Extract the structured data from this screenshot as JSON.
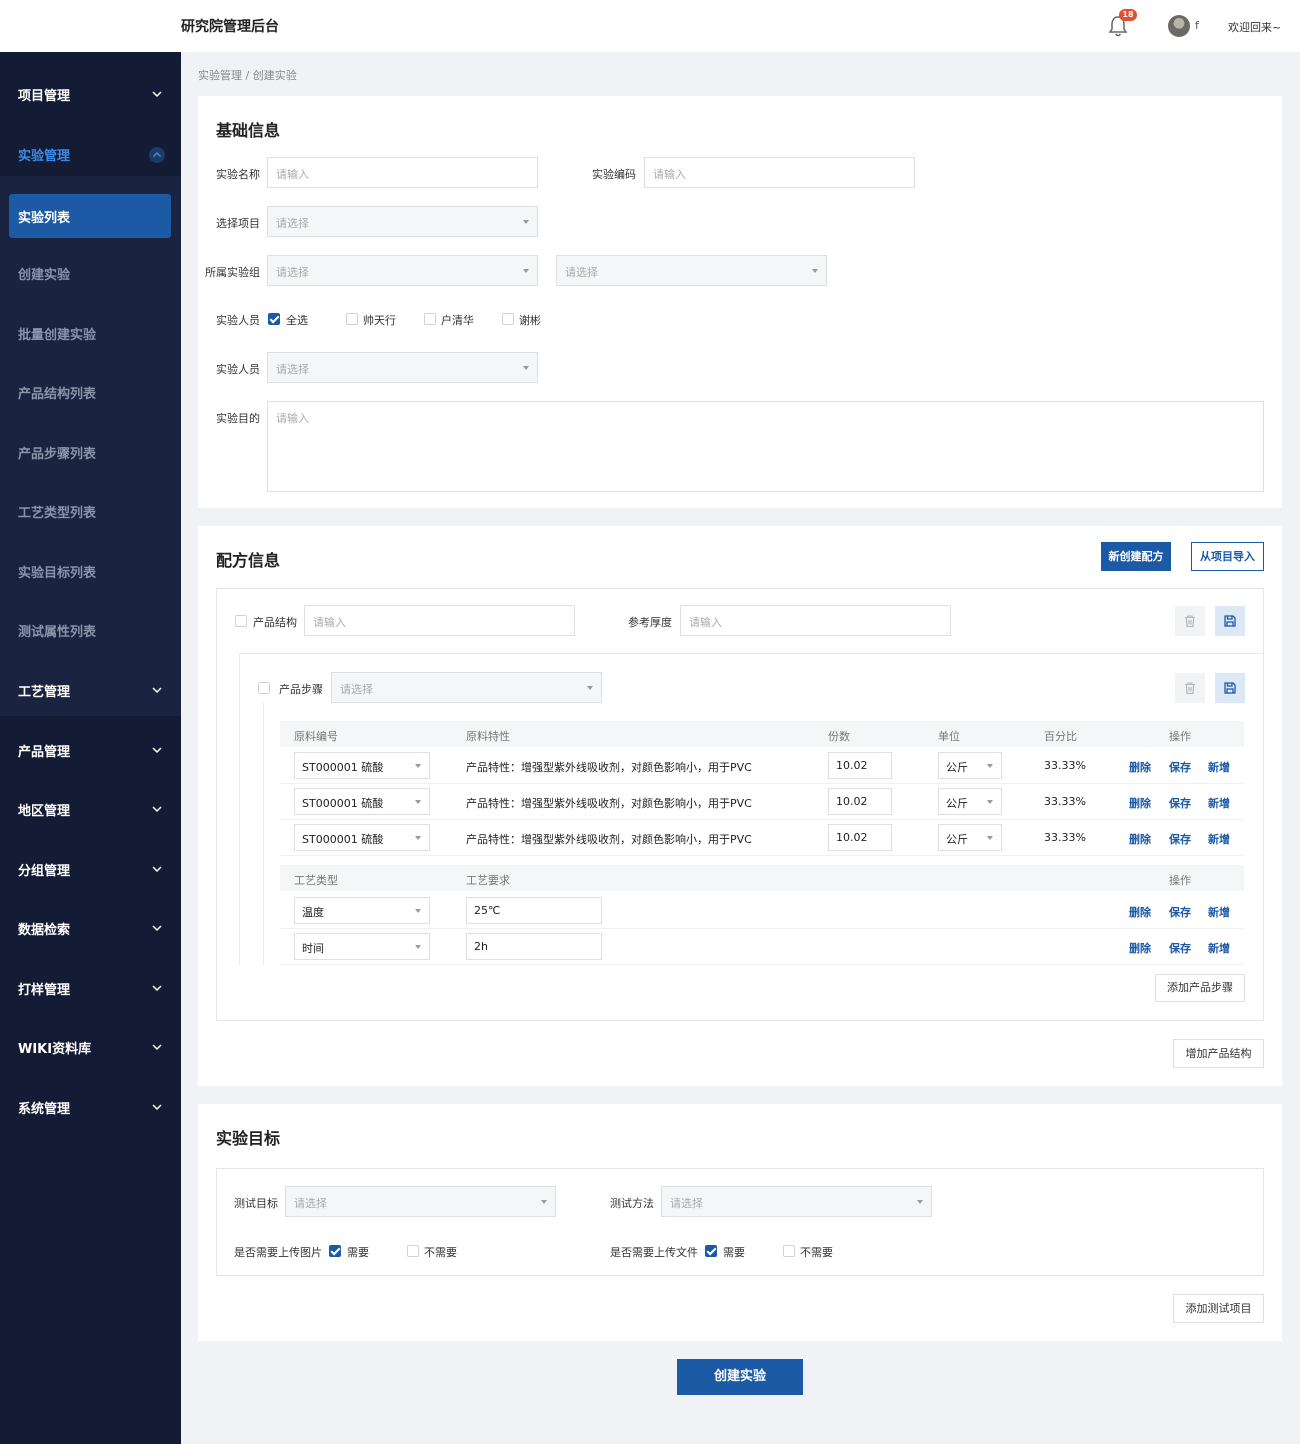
{
  "header": {
    "app_title": "研究院管理后台",
    "notification_count": "18",
    "user_initial": "f",
    "welcome": "欢迎回来~"
  },
  "sidebar": {
    "groups_top": [
      {
        "label": "项目管理"
      }
    ],
    "expanded_group": {
      "label": "实验管理"
    },
    "sub_items": [
      {
        "label": "实验列表",
        "active": true
      },
      {
        "label": "创建实验"
      },
      {
        "label": "批量创建实验"
      },
      {
        "label": "产品结构列表"
      },
      {
        "label": "产品步骤列表"
      },
      {
        "label": "工艺类型列表"
      },
      {
        "label": "实验目标列表"
      },
      {
        "label": "测试属性列表"
      }
    ],
    "groups_bottom": [
      {
        "label": "工艺管理"
      },
      {
        "label": "产品管理"
      },
      {
        "label": "地区管理"
      },
      {
        "label": "分组管理"
      },
      {
        "label": "数据检索"
      },
      {
        "label": "打样管理"
      },
      {
        "label": "WIKI资料库"
      },
      {
        "label": "系统管理"
      }
    ]
  },
  "breadcrumb": "实验管理 / 创建实验",
  "basic": {
    "title": "基础信息",
    "name_label": "实验名称",
    "name_placeholder": "请输入",
    "code_label": "实验编码",
    "code_placeholder": "请输入",
    "project_label": "选择项目",
    "project_placeholder": "请选择",
    "group_label": "所属实验组",
    "group_placeholder_1": "请选择",
    "group_placeholder_2": "请选择",
    "staff_label": "实验人员",
    "staff_options": [
      {
        "label": "全选",
        "checked": true
      },
      {
        "label": "帅天行",
        "checked": false
      },
      {
        "label": "户清华",
        "checked": false
      },
      {
        "label": "谢彬",
        "checked": false
      }
    ],
    "staff_select_label": "实验人员",
    "staff_select_placeholder": "请选择",
    "purpose_label": "实验目的",
    "purpose_placeholder": "请输入"
  },
  "formula": {
    "title": "配方信息",
    "new_button": "新创建配方",
    "import_button": "从项目导入",
    "structure_label": "产品结构",
    "structure_placeholder": "请输入",
    "thickness_label": "参考厚度",
    "thickness_placeholder": "请输入",
    "step_label": "产品步骤",
    "step_placeholder": "请选择",
    "material_headers": [
      "原料编号",
      "原料特性",
      "份数",
      "单位",
      "百分比",
      "操作"
    ],
    "materials": [
      {
        "code": "ST000001 硫酸",
        "feature": "产品特性：增强型紫外线吸收剂，对颜色影响小，用于PVC",
        "parts": "10.02",
        "unit": "公斤",
        "percent": "33.33%"
      },
      {
        "code": "ST000001 硫酸",
        "feature": "产品特性：增强型紫外线吸收剂，对颜色影响小，用于PVC",
        "parts": "10.02",
        "unit": "公斤",
        "percent": "33.33%"
      },
      {
        "code": "ST000001 硫酸",
        "feature": "产品特性：增强型紫外线吸收剂，对颜色影响小，用于PVC",
        "parts": "10.02",
        "unit": "公斤",
        "percent": "33.33%"
      }
    ],
    "process_headers": [
      "工艺类型",
      "工艺要求",
      "操作"
    ],
    "processes": [
      {
        "type": "温度",
        "requirement": "25℃"
      },
      {
        "type": "时间",
        "requirement": "2h"
      }
    ],
    "actions": {
      "delete": "删除",
      "save": "保存",
      "add": "新增"
    },
    "add_step_button": "添加产品步骤",
    "add_structure_button": "增加产品结构"
  },
  "target": {
    "title": "实验目标",
    "test_target_label": "测试目标",
    "test_target_placeholder": "请选择",
    "test_method_label": "测试方法",
    "test_method_placeholder": "请选择",
    "upload_image_label": "是否需要上传图片",
    "upload_file_label": "是否需要上传文件",
    "need": "需要",
    "no_need": "不需要",
    "add_test_button": "添加测试项目"
  },
  "submit_button": "创建实验",
  "colors": {
    "primary": "#1c5aa6",
    "sidebar": "#141c35",
    "badge": "#e4502f"
  }
}
